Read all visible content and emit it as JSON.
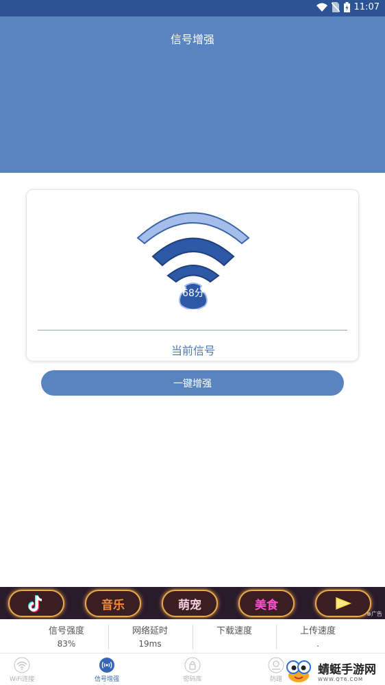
{
  "status_bar": {
    "time": "11:07"
  },
  "header": {
    "title": "信号增强"
  },
  "signal_card": {
    "score": "68分",
    "label": "当前信号"
  },
  "boost_button": {
    "label": "一键增强"
  },
  "ad_banner": {
    "items": [
      {
        "label": "",
        "icon": "tiktok-icon",
        "color": "#ffffff"
      },
      {
        "label": "音乐",
        "color": "#f28a3c"
      },
      {
        "label": "萌宠",
        "color": "#f5cde0"
      },
      {
        "label": "美食",
        "color": "#ff4fd1"
      },
      {
        "label": "",
        "icon": "play-icon",
        "color": "#ffe98a"
      }
    ],
    "tag": "广告"
  },
  "stats": [
    {
      "label": "信号强度",
      "value": "83%"
    },
    {
      "label": "网络延时",
      "value": "19ms"
    },
    {
      "label": "下载速度",
      "value": ""
    },
    {
      "label": "上传速度",
      "value": "."
    }
  ],
  "nav": {
    "items": [
      {
        "label": "WiFi连接",
        "active": false
      },
      {
        "label": "信号增强",
        "active": true
      },
      {
        "label": "密码库",
        "active": false
      },
      {
        "label": "防蹭",
        "active": false
      }
    ]
  },
  "watermark": {
    "name": "蜻蜓手游网",
    "url": "WWW.QT6.COM"
  },
  "colors": {
    "primary": "#5a84bf",
    "status_bar": "#2c5495",
    "wifi_dark": "#2d58a5",
    "wifi_light": "#a5bdeb"
  }
}
